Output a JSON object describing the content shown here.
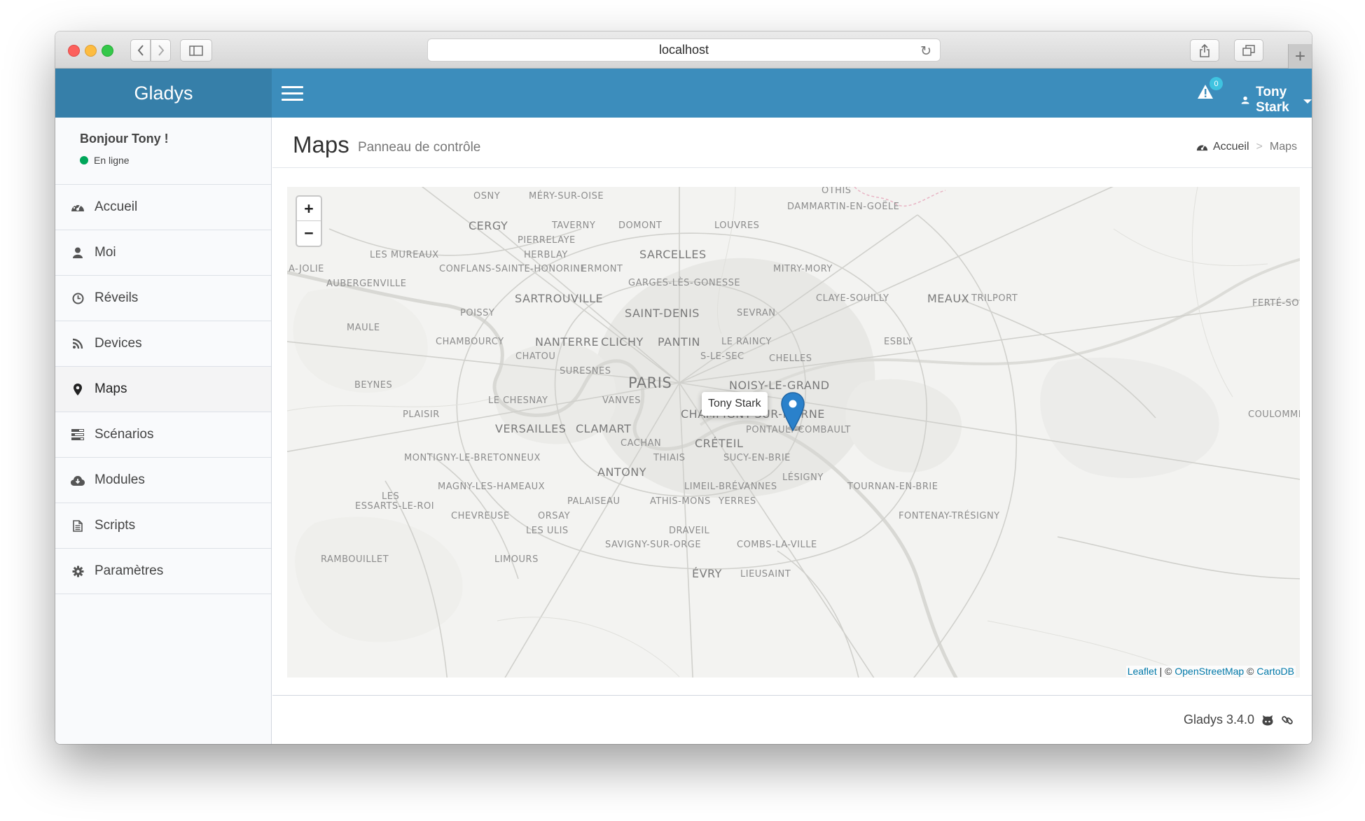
{
  "browser": {
    "url": "localhost"
  },
  "app": {
    "logo": "Gladys",
    "notifications_count": "0",
    "user_name": "Tony Stark"
  },
  "sidebar": {
    "greeting": "Bonjour Tony !",
    "status": "En ligne",
    "status_color": "#00a65a",
    "items": [
      {
        "label": "Accueil",
        "icon": "dashboard-icon"
      },
      {
        "label": "Moi",
        "icon": "user-icon"
      },
      {
        "label": "Réveils",
        "icon": "clock-icon"
      },
      {
        "label": "Devices",
        "icon": "rss-icon"
      },
      {
        "label": "Maps",
        "icon": "map-marker-icon",
        "active": true
      },
      {
        "label": "Scénarios",
        "icon": "tasks-icon"
      },
      {
        "label": "Modules",
        "icon": "cloud-download-icon"
      },
      {
        "label": "Scripts",
        "icon": "file-text-icon"
      },
      {
        "label": "Paramètres",
        "icon": "gear-icon"
      }
    ]
  },
  "header": {
    "title": "Maps",
    "subtitle": "Panneau de contrôle",
    "breadcrumb": {
      "home": "Accueil",
      "separator": ">",
      "current": "Maps"
    }
  },
  "map": {
    "zoom_in": "+",
    "zoom_out": "−",
    "popup": "Tony Stark",
    "marker_color": "#2a81cb",
    "attribution": {
      "leaflet": "Leaflet",
      "sep1": " | © ",
      "osm": "OpenStreetMap",
      "sep2": " © ",
      "carto": "CartoDB"
    },
    "places": [
      "OSNY",
      "MÉRY-SUR-OISE",
      "OTHIS",
      "DAMMARTIN-EN-GOËLE",
      "CERGY",
      "TAVERNY",
      "DOMONT",
      "LOUVRES",
      "PIERRELAYE",
      "HERBLAY",
      "LES MUREAUX",
      "SARCELLES",
      "A-JOLIE",
      "CONFLANS-SAINTE-HONORINE",
      "ERMONT",
      "MITRY-MORY",
      "AUBERGENVILLE",
      "GARGES-LÈS-GONESSE",
      "SARTROUVILLE",
      "CLAYE-SOUILLY",
      "MEAUX",
      "TRILPORT",
      "FERTÉ-SOU",
      "POISSY",
      "SAINT-DENIS",
      "SEVRAN",
      "MAULE",
      "CHAMBOURCY",
      "NANTERRE",
      "CLICHY",
      "PANTIN",
      "LE RAINCY",
      "ESBLY",
      "CHATOU",
      "S-LE-SEC",
      "CHELLES",
      "SURESNES",
      "PARIS",
      "NOISY-LE-GRAND",
      "BEYNES",
      "LE CHESNAY",
      "VANVES",
      "PLAISIR",
      "CHAMPIGNY-SUR-MARNE",
      "VERSAILLES",
      "CLAMART",
      "PONTAULT-COMBAULT",
      "COULOMMIERS",
      "CRÉTEIL",
      "CACHAN",
      "MONTIGNY-LE-BRETONNEUX",
      "THIAIS",
      "SUCY-EN-BRIE",
      "ANTONY",
      "LÉSIGNY",
      "MAGNY-LES-HAMEAUX",
      "LIMEIL-BRÉVANNES",
      "TOURNAN-EN-BRIE",
      "LES",
      "PALAISEAU",
      "ATHIS-MONS",
      "YERRES",
      "ESSARTS-LE-ROI",
      "CHEVREUSE",
      "ORSAY",
      "FONTENAY-TRÉSIGNY",
      "LES ULIS",
      "DRAVEIL",
      "SAVIGNY-SUR-ORGE",
      "COMBS-LA-VILLE",
      "RAMBOUILLET",
      "LIMOURS",
      "ÉVRY",
      "LIEUSAINT"
    ]
  },
  "footer": {
    "version": "Gladys 3.4.0"
  }
}
